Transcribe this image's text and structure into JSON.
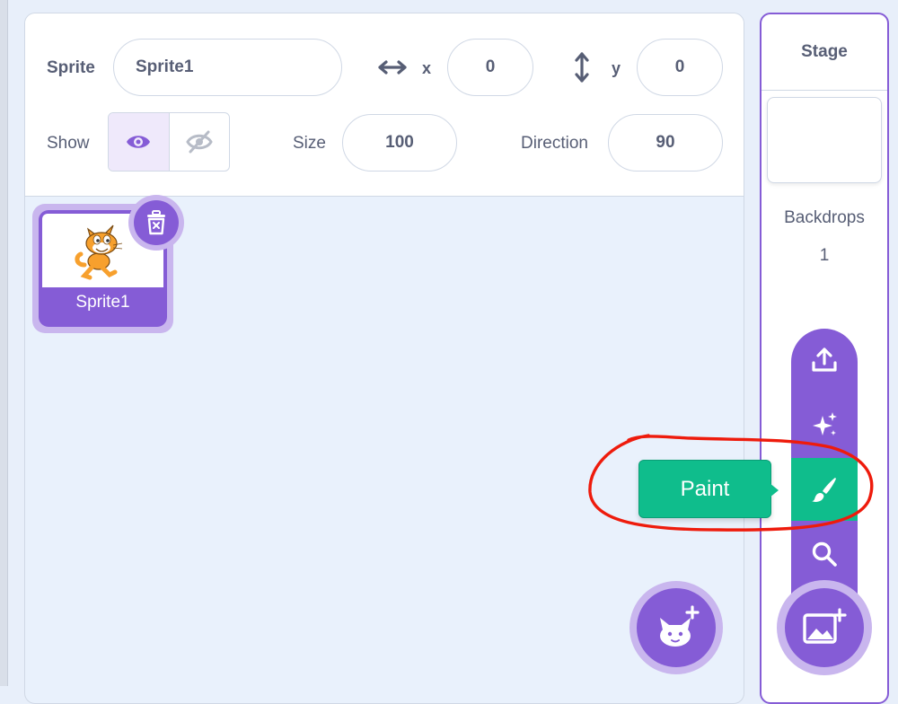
{
  "sprite_info": {
    "sprite_label": "Sprite",
    "sprite_name": "Sprite1",
    "x_label": "x",
    "x_value": "0",
    "y_label": "y",
    "y_value": "0",
    "show_label": "Show",
    "show_visible_selected": true,
    "size_label": "Size",
    "size_value": "100",
    "direction_label": "Direction",
    "direction_value": "90"
  },
  "sprites": [
    {
      "name": "Sprite1",
      "selected": true,
      "costume_icon": "scratch-cat"
    }
  ],
  "stage": {
    "title": "Stage",
    "backdrops_label": "Backdrops",
    "backdrops_count": "1"
  },
  "backdrop_menu": {
    "items": [
      {
        "name": "upload",
        "icon": "upload-icon"
      },
      {
        "name": "surprise",
        "icon": "sparkles-icon"
      },
      {
        "name": "paint",
        "icon": "paintbrush-icon",
        "active": true
      },
      {
        "name": "search",
        "icon": "search-icon"
      }
    ],
    "tooltip": "Paint"
  },
  "colors": {
    "purple": "#855cd6",
    "purple_light": "#c9b6ee",
    "green": "#0fbd8c",
    "annotation_red": "#ee1b0c",
    "text": "#575e75",
    "background": "#e9f1fc"
  }
}
